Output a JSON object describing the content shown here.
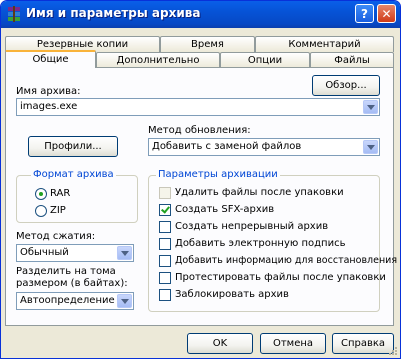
{
  "window": {
    "title": "Имя и параметры архива",
    "help_label": "?",
    "close_label": "✕"
  },
  "tabs_back": [
    "Резервные копии",
    "Время",
    "Комментарий"
  ],
  "tabs_front": [
    "Общие",
    "Дополнительно",
    "Опции",
    "Файлы"
  ],
  "archive_name": {
    "label": "Имя архива:",
    "value": "images.exe",
    "browse_label": "Обзор..."
  },
  "profiles_label": "Профили...",
  "update_method": {
    "label": "Метод обновления:",
    "value": "Добавить с заменой файлов"
  },
  "format": {
    "title": "Формат архива",
    "options": [
      "RAR",
      "ZIP"
    ],
    "selected": "RAR"
  },
  "compression": {
    "label": "Метод сжатия:",
    "value": "Обычный"
  },
  "split": {
    "label_line1": "Разделить на тома",
    "label_line2": "размером (в байтах):",
    "value": "Автоопределение"
  },
  "params": {
    "title": "Параметры архивации",
    "items": [
      {
        "label": "Удалить файлы после упаковки",
        "checked": false,
        "enabled": false
      },
      {
        "label": "Создать SFX-архив",
        "checked": true,
        "enabled": true
      },
      {
        "label": "Создать непрерывный архив",
        "checked": false,
        "enabled": true
      },
      {
        "label": "Добавить электронную подпись",
        "checked": false,
        "enabled": true
      },
      {
        "label": "Добавить информацию для восстановления",
        "checked": false,
        "enabled": true
      },
      {
        "label": "Протестировать файлы после упаковки",
        "checked": false,
        "enabled": true
      },
      {
        "label": "Заблокировать архив",
        "checked": false,
        "enabled": true
      }
    ]
  },
  "buttons": {
    "ok": "OK",
    "cancel": "Отмена",
    "help": "Справка"
  },
  "colors": {
    "titlebar": "#0653d6",
    "group_title": "#0046d5",
    "face": "#ece9d8"
  }
}
